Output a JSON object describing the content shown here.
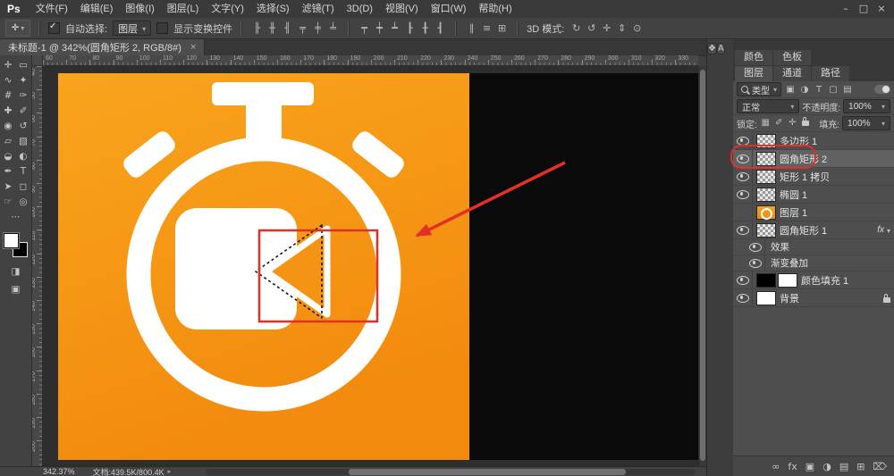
{
  "app": {
    "logo": "Ps"
  },
  "window_controls": [
    {
      "name": "minimize-button",
      "glyph": "–"
    },
    {
      "name": "restore-button",
      "glyph": "□"
    },
    {
      "name": "close-button",
      "glyph": "×"
    }
  ],
  "menu_bar": {
    "items": [
      "文件(F)",
      "编辑(E)",
      "图像(I)",
      "图层(L)",
      "文字(Y)",
      "选择(S)",
      "滤镜(T)",
      "3D(D)",
      "视图(V)",
      "窗口(W)",
      "帮助(H)"
    ]
  },
  "options_bar": {
    "auto_select_label": "自动选择:",
    "auto_select_checked": true,
    "auto_select_value": "图层",
    "show_transform_label": "显示变换控件",
    "show_transform_checked": false,
    "mode_3d_label": "3D 模式:",
    "align_icons": [
      {
        "name": "align-left-icon",
        "glyph": "╟"
      },
      {
        "name": "align-center-h-icon",
        "glyph": "╫"
      },
      {
        "name": "align-right-icon",
        "glyph": "╢"
      },
      {
        "name": "align-top-icon",
        "glyph": "╤"
      },
      {
        "name": "align-center-v-icon",
        "glyph": "╪"
      },
      {
        "name": "align-bottom-icon",
        "glyph": "╧"
      }
    ],
    "distribute_icons": [
      {
        "name": "distribute-top-icon",
        "glyph": "┯"
      },
      {
        "name": "distribute-center-v-icon",
        "glyph": "┿"
      },
      {
        "name": "distribute-bottom-icon",
        "glyph": "┷"
      },
      {
        "name": "distribute-left-icon",
        "glyph": "┠"
      },
      {
        "name": "distribute-center-h-icon",
        "glyph": "╂"
      },
      {
        "name": "distribute-right-icon",
        "glyph": "┨"
      }
    ],
    "extra_icons": [
      {
        "name": "distribute-width-icon",
        "glyph": "∥"
      },
      {
        "name": "distribute-height-icon",
        "glyph": "≡"
      },
      {
        "name": "auto-align-icon",
        "glyph": "⊞"
      }
    ],
    "mode3d_icons": [
      {
        "name": "3d-rotate-icon",
        "glyph": "↻"
      },
      {
        "name": "3d-roll-icon",
        "glyph": "↺"
      },
      {
        "name": "3d-drag-icon",
        "glyph": "✛"
      },
      {
        "name": "3d-slide-icon",
        "glyph": "⇕"
      },
      {
        "name": "3d-scale-icon",
        "glyph": "⊙"
      }
    ]
  },
  "document_tab": {
    "title": "未标题-1 @ 342%(圆角矩形 2, RGB/8#)",
    "close_glyph": "×"
  },
  "toolbar": {
    "tools": [
      {
        "name": "move-tool",
        "glyph": "✛"
      },
      {
        "name": "rect-marquee-tool",
        "glyph": "▭"
      },
      {
        "name": "lasso-tool",
        "glyph": "∿"
      },
      {
        "name": "quick-select-tool",
        "glyph": "✦"
      },
      {
        "name": "crop-tool",
        "glyph": "#"
      },
      {
        "name": "eyedropper-tool",
        "glyph": "✑"
      },
      {
        "name": "healing-brush-tool",
        "glyph": "✚"
      },
      {
        "name": "brush-tool",
        "glyph": "✐"
      },
      {
        "name": "clone-stamp-tool",
        "glyph": "◉"
      },
      {
        "name": "history-brush-tool",
        "glyph": "↺"
      },
      {
        "name": "eraser-tool",
        "glyph": "▱"
      },
      {
        "name": "gradient-tool",
        "glyph": "▧"
      },
      {
        "name": "blur-tool",
        "glyph": "◒"
      },
      {
        "name": "dodge-tool",
        "glyph": "◐"
      },
      {
        "name": "pen-tool",
        "glyph": "✒"
      },
      {
        "name": "type-tool",
        "glyph": "T"
      },
      {
        "name": "path-select-tool",
        "glyph": "➤"
      },
      {
        "name": "shape-tool",
        "glyph": "◻"
      },
      {
        "name": "hand-tool",
        "glyph": "☞"
      },
      {
        "name": "zoom-tool",
        "glyph": "◎"
      },
      {
        "name": "edit-toolbar-icon",
        "glyph": "⋯"
      }
    ],
    "bottom_icons": [
      {
        "name": "quick-mask-icon",
        "glyph": "◨"
      },
      {
        "name": "screen-mode-icon",
        "glyph": "▣"
      }
    ]
  },
  "ruler": {
    "top_labels": [
      "60",
      "70",
      "80",
      "90",
      "100",
      "110",
      "120",
      "130",
      "140",
      "150",
      "160",
      "170",
      "180",
      "190",
      "200",
      "210",
      "220",
      "230",
      "240",
      "250",
      "260",
      "270",
      "280",
      "290",
      "300",
      "310",
      "320",
      "330"
    ],
    "left_labels": [
      "40",
      "50",
      "60",
      "70",
      "80",
      "90",
      "100",
      "110",
      "120",
      "130",
      "140",
      "150",
      "160",
      "170",
      "180",
      "190",
      "200"
    ]
  },
  "panel_strip": {
    "icons": [
      {
        "name": "collapsed-panel-icon-1",
        "glyph": "❖"
      },
      {
        "name": "collapsed-panel-icon-2",
        "glyph": "A"
      }
    ]
  },
  "panels": {
    "tab_group1": [
      "颜色",
      "色板"
    ],
    "tab_group2": [
      "图层",
      "通道",
      "路径"
    ],
    "active_tab": "图层"
  },
  "layers": {
    "filter_label": "类型",
    "blend_mode": "正常",
    "opacity_label": "不透明度:",
    "opacity_value": "100%",
    "lock_label": "锁定:",
    "fill_label": "填充:",
    "fill_value": "100%",
    "fx_label": "fx",
    "filter_icons": [
      {
        "name": "filter-pixel-layers-icon",
        "glyph": "▣"
      },
      {
        "name": "filter-adjustment-layers-icon",
        "glyph": "◑"
      },
      {
        "name": "filter-type-layers-icon",
        "glyph": "T"
      },
      {
        "name": "filter-shape-layers-icon",
        "glyph": "▢"
      },
      {
        "name": "filter-smart-objects-icon",
        "glyph": "▤"
      }
    ],
    "lock_icons": [
      {
        "name": "lock-transparency-icon",
        "glyph": "▦"
      },
      {
        "name": "lock-pixels-icon",
        "glyph": "✐"
      },
      {
        "name": "lock-position-icon",
        "glyph": "✛"
      },
      {
        "name": "lock-all-icon",
        "glyph": "lock"
      }
    ],
    "rows": [
      {
        "name": "多边形 1",
        "visible": true,
        "thumb": "checker"
      },
      {
        "name": "圆角矩形 2",
        "visible": true,
        "thumb": "checker",
        "selected": true,
        "annotated": true
      },
      {
        "name": "矩形 1 拷贝",
        "visible": true,
        "thumb": "checker"
      },
      {
        "name": "椭圆 1",
        "visible": true,
        "thumb": "checker"
      },
      {
        "name": "图层 1",
        "visible": false,
        "thumb": "orange"
      },
      {
        "name": "圆角矩形 1",
        "visible": true,
        "thumb": "checker",
        "fx": true
      },
      {
        "name": "效果",
        "visible": true,
        "type": "effect"
      },
      {
        "name": "渐变叠加",
        "visible": true,
        "type": "effect"
      },
      {
        "name": "颜色填充 1",
        "visible": true,
        "thumb": "black",
        "mask": "white"
      },
      {
        "name": "背景",
        "visible": true,
        "thumb": "white",
        "locked": true
      }
    ],
    "bottom_icons": [
      {
        "name": "link-layers-icon",
        "glyph": "∞"
      },
      {
        "name": "layer-style-icon",
        "glyph": "fx"
      },
      {
        "name": "add-mask-icon",
        "glyph": "▣"
      },
      {
        "name": "adjustment-layer-icon",
        "glyph": "◑"
      },
      {
        "name": "new-group-icon",
        "glyph": "▤"
      },
      {
        "name": "new-layer-icon",
        "glyph": "⊞"
      },
      {
        "name": "delete-layer-icon",
        "glyph": "⌦"
      }
    ]
  },
  "status_bar": {
    "zoom_value": "342.37%",
    "doc_info": "文档:439.5K/800.4K",
    "expand_arrow": "▸"
  },
  "colors": {
    "canvas_orange_top": "#f9a41d",
    "canvas_orange_bottom": "#f28a0e",
    "canvas_black": "#0a0a0a",
    "stopwatch_white": "#ffffff",
    "annotation_red": "#e23028"
  }
}
